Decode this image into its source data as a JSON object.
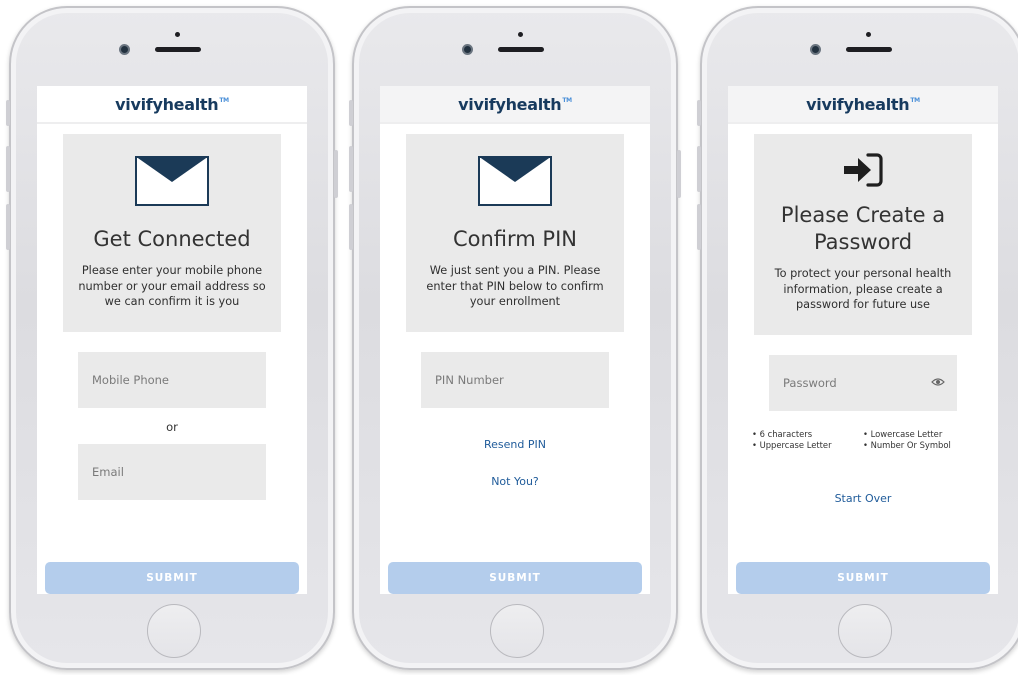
{
  "brand": {
    "name": "vivifyhealth",
    "mark": "TM"
  },
  "phone1": {
    "title": "Get Connected",
    "text": "Please enter your mobile phone number or your email address so we can confirm it is you",
    "phone_placeholder": "Mobile Phone",
    "or": "or",
    "email_placeholder": "Email",
    "submit": "SUBMIT",
    "icon": "envelope-icon"
  },
  "phone2": {
    "title": "Confirm PIN",
    "text": "We just sent you a PIN. Please enter that PIN below to confirm your enrollment",
    "pin_placeholder": "PIN Number",
    "resend": "Resend PIN",
    "not_you": "Not You?",
    "submit": "SUBMIT",
    "icon": "envelope-icon"
  },
  "phone3": {
    "title": "Please Create a Password",
    "text": "To protect your personal health information, please create a password for future use",
    "password_placeholder": "Password",
    "rules": [
      "6 characters",
      "Lowercase Letter",
      "Uppercase Letter",
      "Number Or Symbol"
    ],
    "start_over": "Start Over",
    "submit": "SUBMIT",
    "icon": "sign-in-icon"
  },
  "colors": {
    "brand_navy": "#173a5e",
    "link_blue": "#1f5b9a",
    "submit_disabled": "#b4cdec",
    "card_gray": "#eaeaea"
  }
}
